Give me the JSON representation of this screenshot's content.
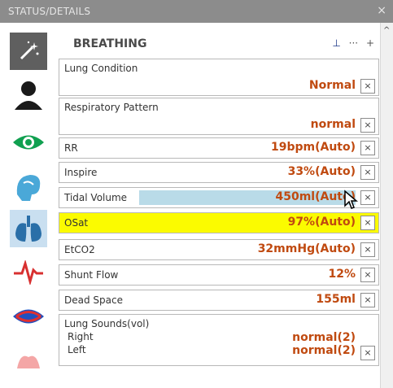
{
  "window": {
    "title": "STATUS/DETAILS",
    "close": "×"
  },
  "sidebar": {
    "items": [
      {
        "name": "magic-wand"
      },
      {
        "name": "person"
      },
      {
        "name": "eye"
      },
      {
        "name": "airway"
      },
      {
        "name": "lungs",
        "active": true
      },
      {
        "name": "ecg"
      },
      {
        "name": "circulation"
      },
      {
        "name": "kidney"
      }
    ]
  },
  "panel": {
    "title": "BREATHING",
    "header_icons": {
      "pin": "⊥",
      "more": "···",
      "add": "+"
    },
    "rows": [
      {
        "label": "Lung Condition",
        "value": "Normal"
      },
      {
        "label": "Respiratory Pattern",
        "value": "normal"
      },
      {
        "label": "RR",
        "value": "19bpm(Auto)"
      },
      {
        "label": "Inspire",
        "value": "33%(Auto)"
      },
      {
        "label": "Tidal Volume",
        "value": "450ml(Auto)"
      },
      {
        "label": "OSat",
        "value": "97%(Auto)"
      },
      {
        "label": "EtCO2",
        "value": "32mmHg(Auto)"
      },
      {
        "label": "Shunt Flow",
        "value": "12%"
      },
      {
        "label": "Dead Space",
        "value": "155ml"
      }
    ],
    "lung_sounds": {
      "label": "Lung Sounds(vol)",
      "right_label": "Right",
      "right_value": "normal(2)",
      "left_label": "Left",
      "left_value": "normal(2)"
    },
    "remove_symbol": "×"
  },
  "scrollbar": {
    "up": "^"
  },
  "colors": {
    "accent_value": "#c04a10",
    "highlight_row": "#fbfb00",
    "tidal_bar": "#b9dbe8",
    "active_tab": "#c9dff0"
  }
}
